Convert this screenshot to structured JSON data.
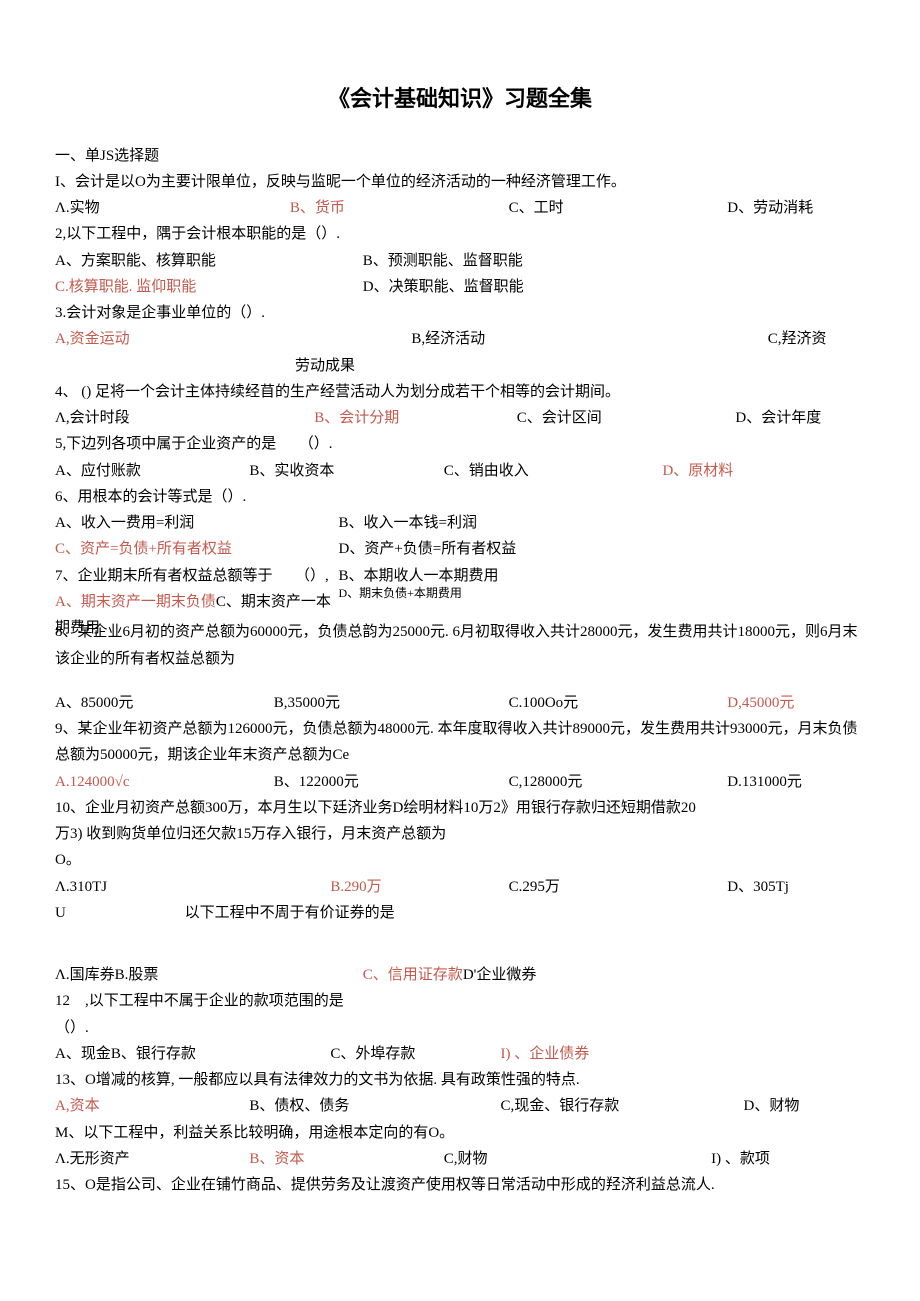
{
  "title": "《会计基础知识》习题全集",
  "section": "一、单JS选择题",
  "q1": {
    "stem": "I、会计是以O为主要计限单位，反映与监昵一个单位的经济活动的一种经济管理工作。",
    "a": "Λ.实物",
    "b": "B、货币",
    "c": "C、工时",
    "d": "D、劳动消耗"
  },
  "q2": {
    "stem": "2,以下工程中，隅于会计根本职能的是（）.",
    "a": "A、方案职能、核算职能",
    "b": "B、预测职能、监督职能",
    "c": "C.核算职能. 监仰职能",
    "d": "D、决策职能、监督职能"
  },
  "q3": {
    "stem": "3.会计对象是企事业单位的（）.",
    "a": "A,资金运动",
    "b": "B,经济活动",
    "c": "C,羟济资",
    "extra": "劳动成果"
  },
  "q4": {
    "stem": "4、 ()  足将一个会计主体持续经苜的生产经营活动人为划分成若干个相等的会计期间。",
    "a": "Λ,会计时段",
    "b": "B、会计分期",
    "c": "C、会计区间",
    "d": "D、会计年度"
  },
  "q5": {
    "stem": "5,下边列各项中属于企业资产的是　　（）.",
    "a": "A、应付账款",
    "b": "B、实收资本",
    "c": "C、销由收入",
    "d": "D、原材料"
  },
  "q6": {
    "stem": "6、用根本的会计等式是（）.",
    "a": "A、收入一费用=利润",
    "b": "B、收入一本钱=利润",
    "c": "C、资产=负债+所有者权益",
    "d": "D、资产+负债=所有者权益"
  },
  "q7": {
    "stem": "7、企业期末所有者权益总额等于　　（）,",
    "a": "A、期末资产一期末负债",
    "c1": "C、期末资产一本期费用",
    "b": "B、本期收人一本期费用",
    "d": "D、期末负债+本期费用"
  },
  "q8": {
    "stem": "8、某企业6月初的资产总额为60000元，负债总韵为25000元. 6月初取得收入共计28000元，发生费用共计18000元，则6月末该企业的所有者权益总额为",
    "a": "A、85000元",
    "b": "B,35000元",
    "c": "C.100Oo元",
    "d": "D,45000元"
  },
  "q9": {
    "stem": "9、某企业年初资产总额为126000元，负债总额为48000元. 本年度取得收入共计89000元，发生费用共计93000元，月末负债总额为50000元，期该企业年末资产总额为Ce",
    "a": "A.124000√c",
    "b": "B、122000元",
    "c": "C,128000元",
    "d": "D.131000元"
  },
  "q10": {
    "stem1": "10、企业月初资产总额300万，本月生以下廷济业务D绘明材料10万2》用银行存款归还短期借款20",
    "stem2": "万3)  收到购货单位归还欠款15万存入银行，月末资产总额为",
    "stem3": "O。",
    "a": "Λ.310TJ",
    "b": "B.290万",
    "c": "C.295万",
    "d": "D、305Tj"
  },
  "q11": {
    "pre": "U",
    "stem": "以下工程中不周于有价证券的是",
    "a": "Λ.国库券B.股票",
    "c": "C、信用证存款",
    "d": "D'企业微券"
  },
  "q12": {
    "stem1": "12　,以下工程中不属于企业的款项范围的是",
    "stem2": "（）.",
    "a": "A、现金B、银行存款",
    "c": "C、外埠存款",
    "d": "I)  、企业债券"
  },
  "q13": {
    "stem": "13、O增减的核算, 一般都应以具有法律效力的文书为依据. 具有政策性强的特点.",
    "a": "A,资本",
    "b": "B、债权、债务",
    "c": "C,现金、银行存款",
    "d": "D、财物"
  },
  "q14": {
    "stem": "M、以下工程中，利益关系比较明确，用途根本定向的有O。",
    "a": "Λ.无形资产",
    "b": "B、资本",
    "c": "C,财物",
    "d": "I) 、款项"
  },
  "q15": {
    "stem": "15、O是指公司、企业在铺竹商品、提供劳务及让渡资产使用权等日常活动中形成的羟济利益总流人."
  }
}
